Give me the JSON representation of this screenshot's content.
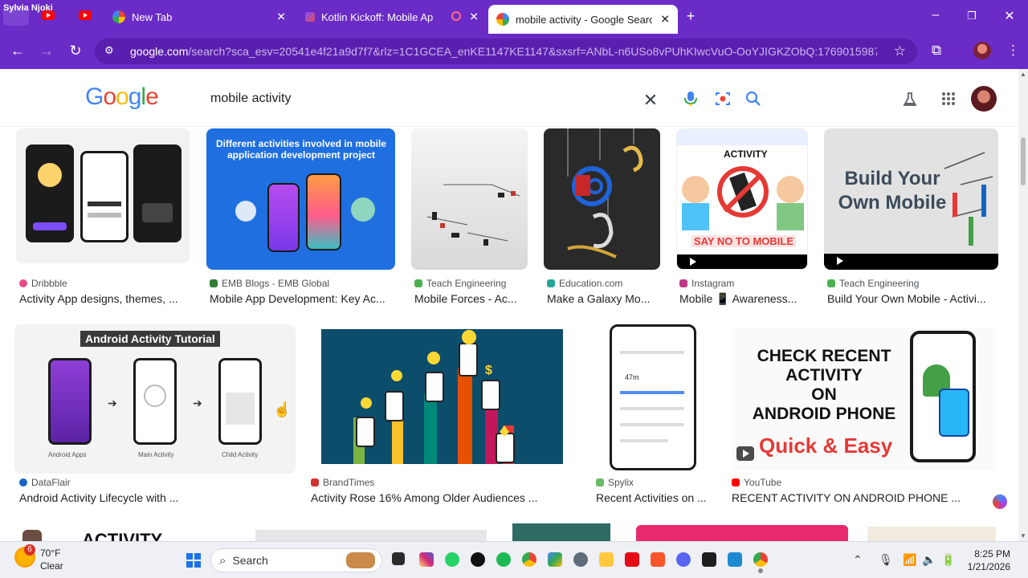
{
  "browser": {
    "profile_name": "Sylvia Njoki",
    "tabs": [
      {
        "label": "New Tab",
        "active": false
      },
      {
        "label": "Kotlin Kickoff: Mobile App",
        "active": false
      },
      {
        "label": "mobile activity - Google Search",
        "active": true
      }
    ],
    "new_tab_symbol": "+",
    "url_host": "google.com",
    "url_rest": "/search?sca_esv=20541e4f21a9d7f7&rlz=1C1GCEA_enKE1147KE1147&sxsrf=ANbL-n6USo8vPUhKIwcVuO-OoYJIGKZObQ:1769015987111...",
    "window_controls": {
      "minimize": "–",
      "restore": "❐",
      "close": "✕"
    }
  },
  "google": {
    "logo_letters": [
      "G",
      "o",
      "o",
      "g",
      "l",
      "e"
    ],
    "query": "mobile activity"
  },
  "results_row1": [
    {
      "source": "Dribbble",
      "title": "Activity App designs, themes, ...",
      "fav_color": "#ea4c89"
    },
    {
      "source": "EMB Blogs - EMB Global",
      "title": "Mobile App Development: Key Ac...",
      "fav_color": "#2e7d32",
      "banner": "Different activities involved in mobile application development project"
    },
    {
      "source": "Teach Engineering",
      "title": "Mobile Forces - Ac...",
      "fav_color": "#4caf50"
    },
    {
      "source": "Education.com",
      "title": "Make a Galaxy Mo...",
      "fav_color": "#26a69a"
    },
    {
      "source": "Instagram",
      "title": "Mobile 📱 Awareness...",
      "fav_color": "#c13584",
      "overlay_top": "ACTIVITY",
      "overlay_bottom": "SAY NO TO MOBILE"
    },
    {
      "source": "Teach Engineering",
      "title": "Build Your Own Mobile - Activi...",
      "fav_color": "#4caf50",
      "overlay": "Build Your Own Mobile"
    }
  ],
  "results_row2": [
    {
      "source": "DataFlair",
      "title": "Android Activity Lifecycle with ...",
      "fav_color": "#1565c0",
      "banner": "Android Activity Tutorial",
      "captions": [
        "Android Apps",
        "Main Activity",
        "Child Activity"
      ]
    },
    {
      "source": "BrandTimes",
      "title": "Activity Rose 16% Among Older Audiences ...",
      "fav_color": "#d32f2f"
    },
    {
      "source": "Spylix",
      "title": "Recent Activities on ...",
      "fav_color": "#66bb6a",
      "phone_time": "47m"
    },
    {
      "source": "YouTube",
      "title": "RECENT ACTIVITY ON ANDROID PHONE ...",
      "fav_color": "#ff0000",
      "overlay_lines": [
        "CHECK RECENT",
        "ACTIVITY",
        "ON",
        "ANDROID PHONE"
      ],
      "overlay_red": "Quick & Easy"
    }
  ],
  "row3_partial_text": "ACTIVITY",
  "taskbar": {
    "temperature": "70°F",
    "condition": "Clear",
    "weather_badge": "6",
    "search_label": "Search",
    "time": "8:25 PM",
    "date": "1/21/2026"
  },
  "colors": {
    "chrome_purple": "#6a2bc6",
    "omnibox_purple": "#5a1fae",
    "google_blue": "#4285f4"
  }
}
